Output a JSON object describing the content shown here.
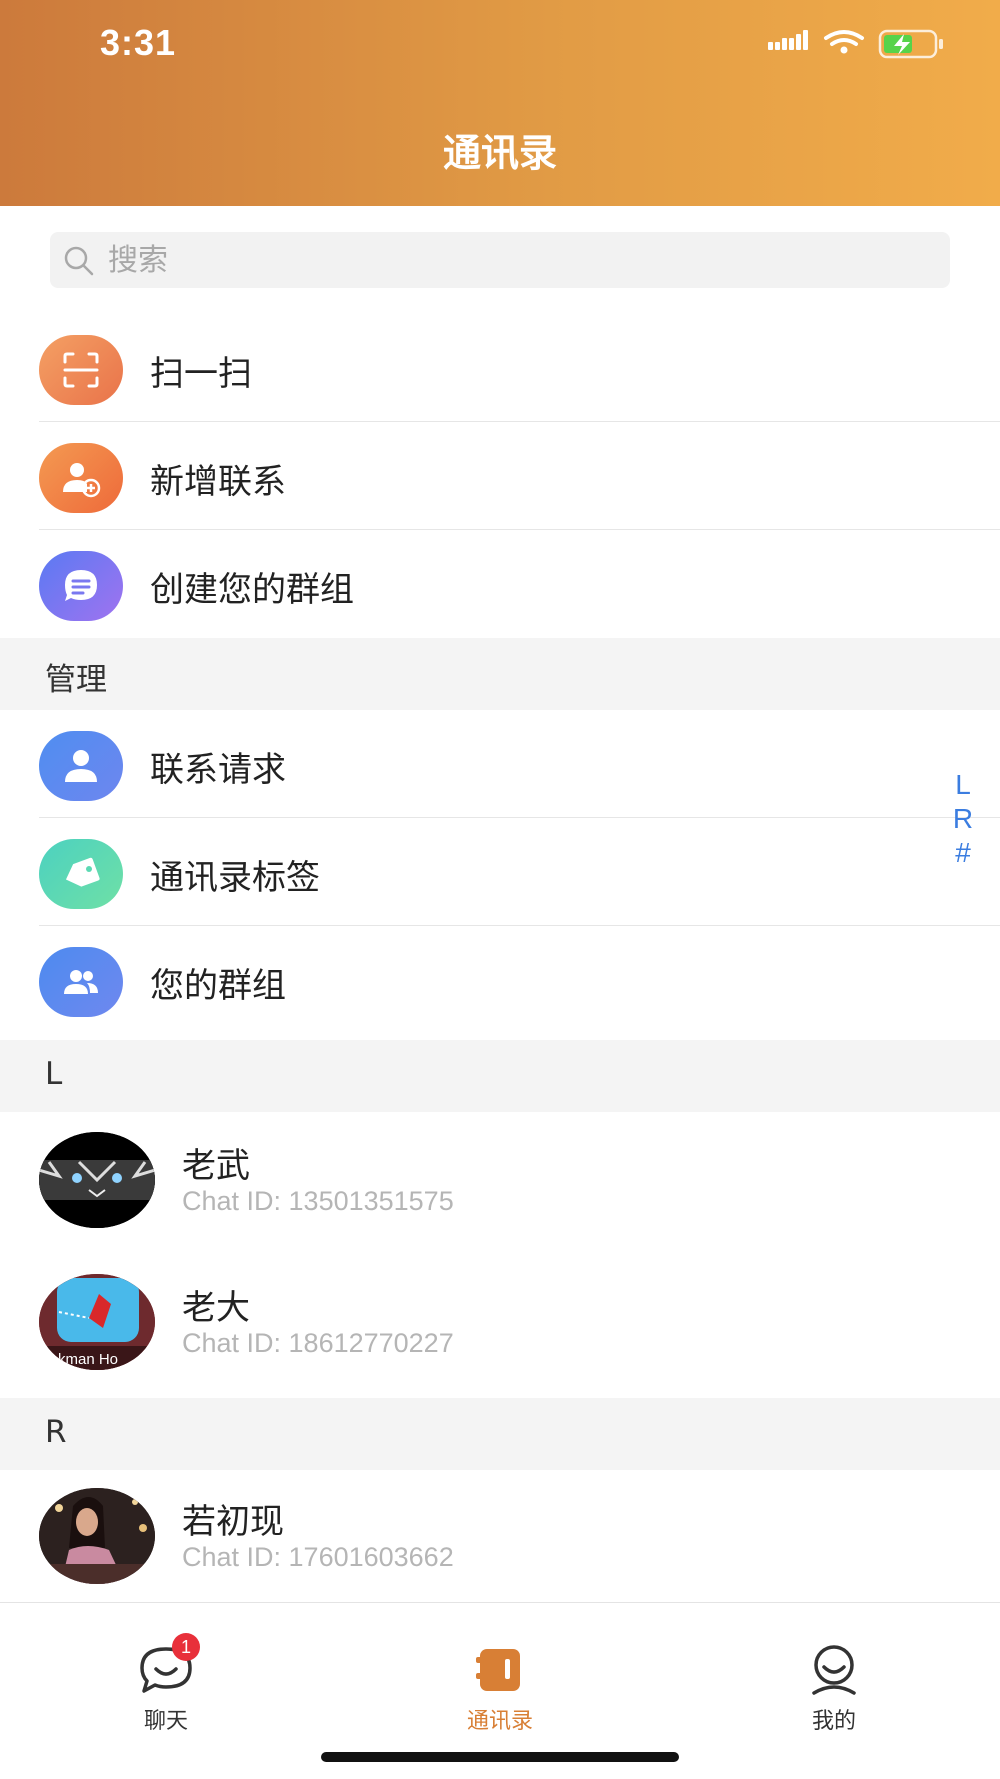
{
  "status": {
    "time": "3:31"
  },
  "header": {
    "title": "通讯录"
  },
  "search": {
    "placeholder": "搜索"
  },
  "actions": [
    {
      "label": "扫一扫",
      "icon": "scan-icon"
    },
    {
      "label": "新增联系",
      "icon": "add-contact-icon"
    },
    {
      "label": "创建您的群组",
      "icon": "create-group-chat-icon"
    }
  ],
  "manage": {
    "title": "管理",
    "items": [
      {
        "label": "联系请求",
        "icon": "person-icon"
      },
      {
        "label": "通讯录标签",
        "icon": "tag-icon"
      },
      {
        "label": "您的群组",
        "icon": "group-icon"
      }
    ]
  },
  "sections": [
    {
      "letter": "L",
      "contacts": [
        {
          "name": "老武",
          "chat_id": "Chat ID: 13501351575"
        },
        {
          "name": "老大",
          "chat_id": "Chat ID: 18612770227",
          "avatar_text": "tickman Ho"
        }
      ]
    },
    {
      "letter": "R",
      "contacts": [
        {
          "name": "若初现",
          "chat_id": "Chat ID: 17601603662"
        }
      ]
    }
  ],
  "index_letters": [
    "L",
    "R",
    "#"
  ],
  "tabbar": {
    "tabs": [
      {
        "label": "聊天",
        "icon": "chat-bubble-icon",
        "badge": "1"
      },
      {
        "label": "通讯录",
        "icon": "contacts-book-icon"
      },
      {
        "label": "我的",
        "icon": "profile-icon"
      }
    ],
    "active_color": "#d87f35"
  },
  "colors": {
    "accent": "#e19b45",
    "index": "#3b7de0",
    "badge": "#e8303a"
  }
}
